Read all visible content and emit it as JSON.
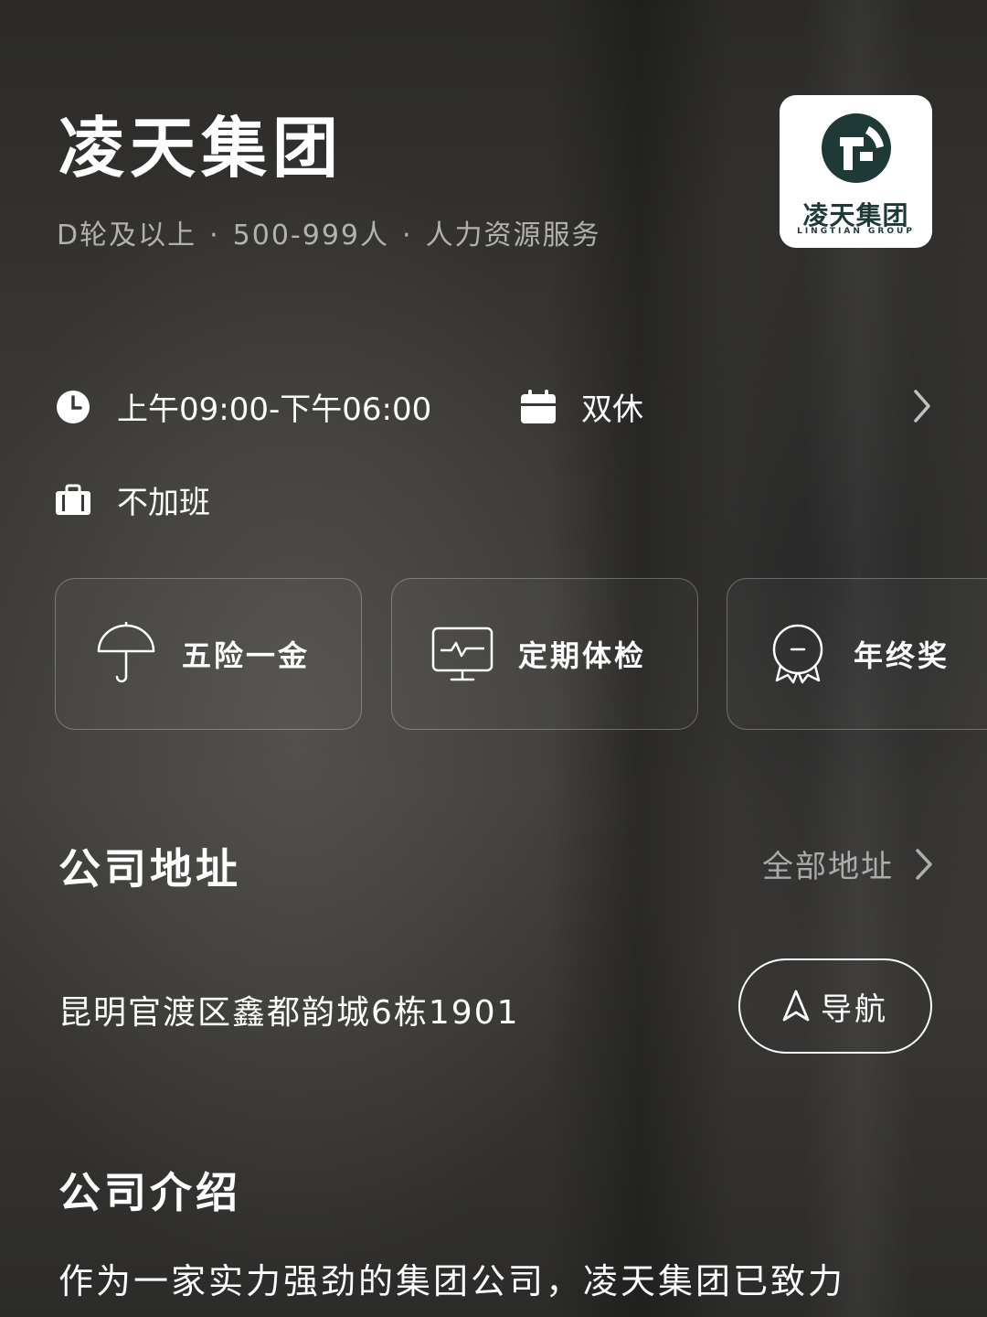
{
  "company": {
    "name": "凌天集团",
    "meta": [
      "D轮及以上",
      "500-999人",
      "人力资源服务"
    ],
    "meta_separator": "·",
    "logo": {
      "text_cn": "凌天集团",
      "text_en": "LINGTIAN GROUP",
      "color": "#1f3a36"
    }
  },
  "work_info": {
    "hours": "上午09:00-下午06:00",
    "hours_icon": "clock-icon",
    "rest": "双休",
    "rest_icon": "calendar-icon",
    "overtime": "不加班",
    "overtime_icon": "briefcase-icon"
  },
  "benefits": [
    {
      "label": "五险一金",
      "icon": "umbrella-icon"
    },
    {
      "label": "定期体检",
      "icon": "monitor-icon"
    },
    {
      "label": "年终奖",
      "icon": "medal-icon"
    }
  ],
  "address_section": {
    "title": "公司地址",
    "all_link": "全部地址",
    "address": "昆明官渡区鑫都韵城6栋1901",
    "nav_button": "导航"
  },
  "intro_section": {
    "title": "公司介绍",
    "text": "作为一家实力强劲的集团公司，凌天集团已致力"
  }
}
